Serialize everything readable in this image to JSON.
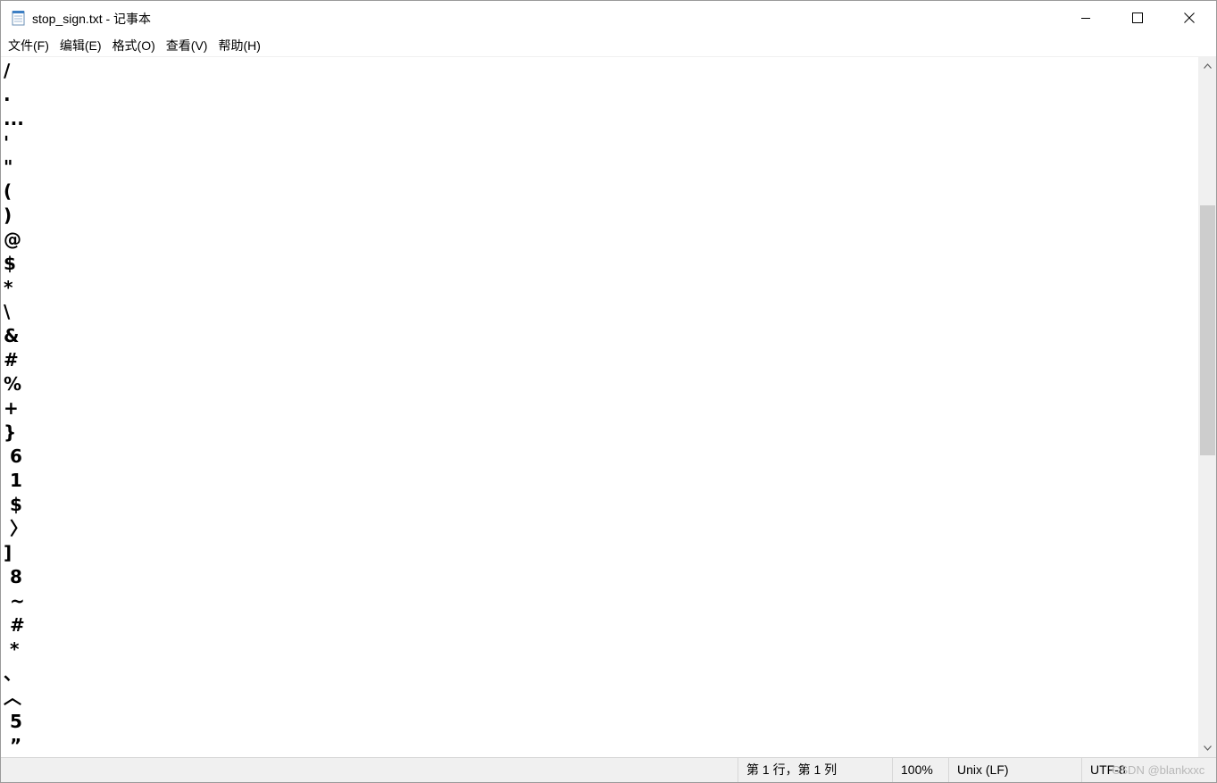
{
  "window": {
    "title": "stop_sign.txt - 记事本"
  },
  "menu": {
    "items": [
      {
        "label": "文件(F)"
      },
      {
        "label": "编辑(E)"
      },
      {
        "label": "格式(O)"
      },
      {
        "label": "查看(V)"
      },
      {
        "label": "帮助(H)"
      }
    ]
  },
  "editor": {
    "lines": [
      "/",
      ".",
      "...",
      "'",
      "\"",
      "(",
      ")",
      "@",
      "$",
      "*",
      "\\",
      "&",
      "#",
      "%",
      "+",
      "}",
      " 6",
      " 1",
      " $",
      " 〉",
      "]",
      " 8",
      " ~",
      " #",
      " *",
      "、",
      "︿",
      " 5",
      " ”"
    ]
  },
  "statusbar": {
    "position": "第 1 行，第 1 列",
    "zoom": "100%",
    "line_ending": "Unix (LF)",
    "encoding": "UTF-8"
  },
  "watermark": {
    "text": "CSDN @blankxxc"
  },
  "icons": {
    "app": "notepad-icon",
    "minimize": "minimize-icon",
    "maximize": "maximize-icon",
    "close": "close-icon",
    "scroll_up": "chevron-up-icon",
    "scroll_down": "chevron-down-icon"
  },
  "colors": {
    "statusbar_bg": "#f0f0f0",
    "scroll_thumb": "#cdcdcd",
    "text": "#000000"
  }
}
